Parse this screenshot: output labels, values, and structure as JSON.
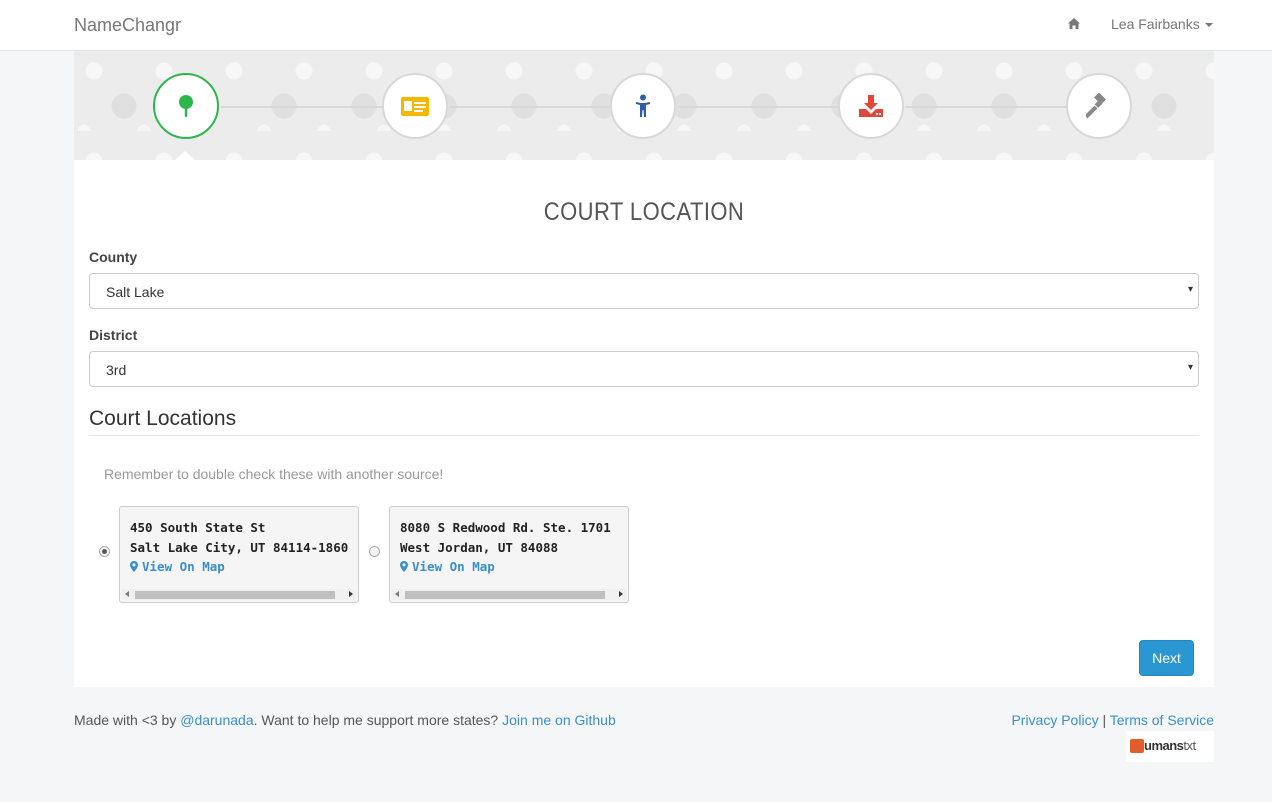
{
  "navbar": {
    "brand": "NameChangr",
    "home_icon": "home-icon",
    "user_name": "Lea Fairbanks"
  },
  "steps": [
    {
      "icon": "map-pin-icon",
      "color": "#2db64a",
      "active": true
    },
    {
      "icon": "id-card-icon",
      "color": "#f5b800",
      "active": false
    },
    {
      "icon": "person-icon",
      "color": "#2d5ea8",
      "active": false
    },
    {
      "icon": "download-icon",
      "color": "#e0463c",
      "active": false
    },
    {
      "icon": "gavel-icon",
      "color": "#888888",
      "active": false
    }
  ],
  "main": {
    "title": "COURT LOCATION",
    "county_label": "County",
    "county_value": "Salt Lake",
    "district_label": "District",
    "district_value": "3rd",
    "section_title": "Court Locations",
    "hint": "Remember to double check these with another source!",
    "locations": [
      {
        "line1": "450 South State St",
        "line2": "Salt Lake City, UT 84114-1860",
        "map_link": "View On Map",
        "selected": true
      },
      {
        "line1": "8080 S Redwood Rd. Ste. 1701",
        "line2": "West Jordan, UT 84088",
        "map_link": "View On Map",
        "selected": false
      }
    ],
    "next_label": "Next"
  },
  "footer": {
    "made_with": "Made with <3 by ",
    "author": "@darunada",
    "help_text": ". Want to help me support more states? ",
    "github_link": "Join me on Github",
    "privacy": "Privacy Policy",
    "separator": "|",
    "terms": "Terms of Service",
    "humans_logo": "humanstxt"
  },
  "colors": {
    "accent": "#2a97d3",
    "link": "#3a8fc7",
    "active_step": "#2db64a"
  }
}
